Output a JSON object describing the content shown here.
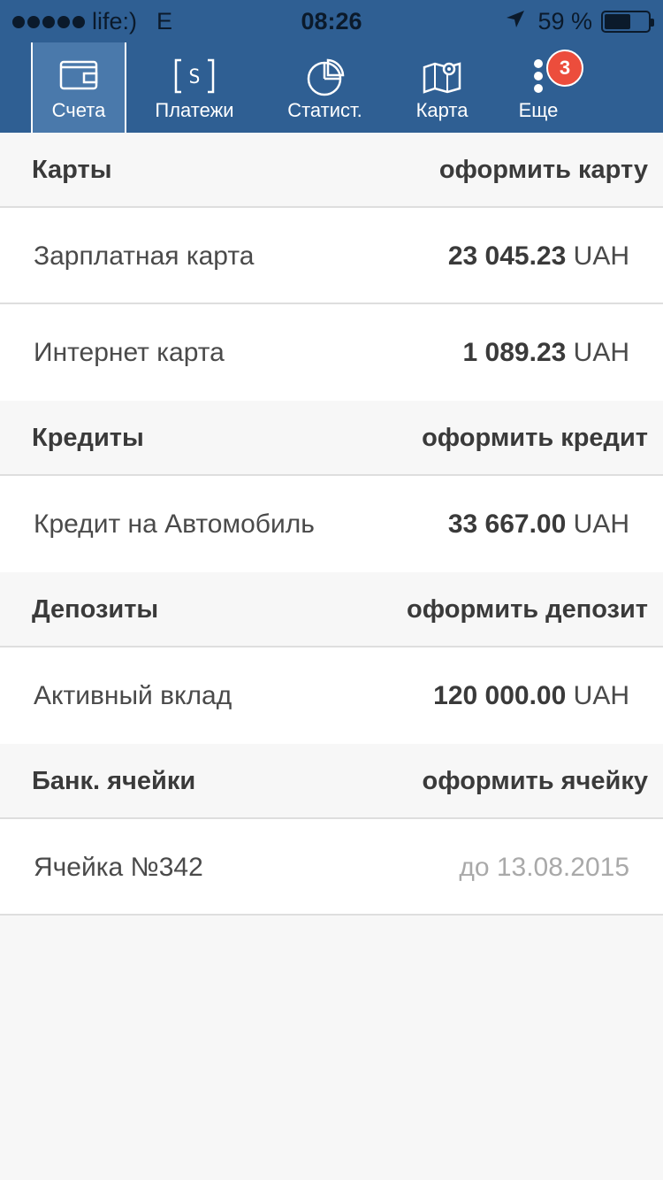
{
  "status_bar": {
    "carrier": "life:)",
    "network": "E",
    "time": "08:26",
    "battery_percent": "59 %",
    "battery_level": 0.6
  },
  "tabs": [
    {
      "label": "Счета",
      "icon": "wallet-icon",
      "active": true
    },
    {
      "label": "Платежи",
      "icon": "payment-icon",
      "active": false
    },
    {
      "label": "Статист.",
      "icon": "pie-chart-icon",
      "active": false
    },
    {
      "label": "Карта",
      "icon": "map-icon",
      "active": false
    },
    {
      "label": "Еще",
      "icon": "more-icon",
      "active": false,
      "badge": "3"
    }
  ],
  "sections": {
    "cards": {
      "title": "Карты",
      "action": "оформить карту",
      "items": [
        {
          "name": "Зарплатная карта",
          "amount": "23 045.23",
          "currency": "UAH"
        },
        {
          "name": "Интернет карта",
          "amount": "1 089.23",
          "currency": "UAH"
        }
      ]
    },
    "credits": {
      "title": "Кредиты",
      "action": "оформить кредит",
      "items": [
        {
          "name": "Кредит на Автомобиль",
          "amount": "33 667.00",
          "currency": "UAH"
        }
      ]
    },
    "deposits": {
      "title": "Депозиты",
      "action": "оформить депозит",
      "items": [
        {
          "name": "Активный вклад",
          "amount": "120 000.00",
          "currency": "UAH"
        }
      ]
    },
    "cells": {
      "title": "Банк. ячейки",
      "action": "оформить ячейку",
      "items": [
        {
          "name": "Ячейка №342",
          "until": "до 13.08.2015"
        }
      ]
    }
  },
  "colors": {
    "header_blue": "#2f5f93",
    "active_tab": "#4a79ab",
    "badge_red": "#ec4d3c"
  }
}
